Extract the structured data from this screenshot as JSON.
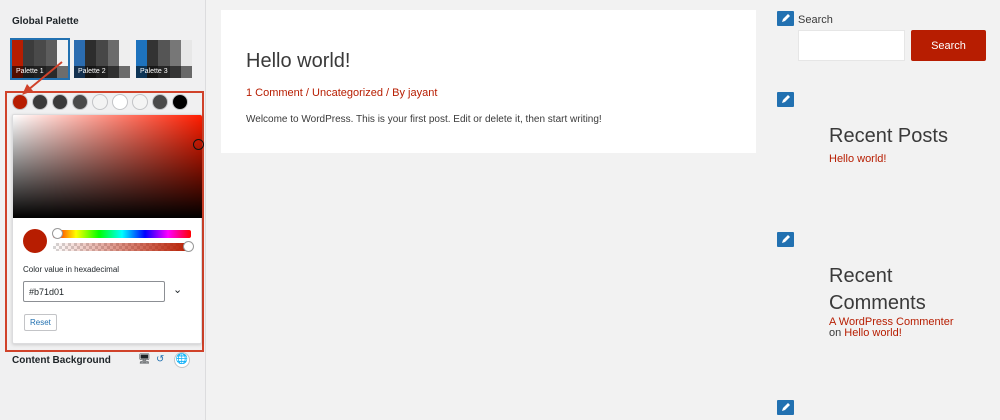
{
  "customizer": {
    "section_title": "Global Palette",
    "palettes": [
      {
        "label": "Palette 1",
        "colors": [
          "#b71d01",
          "#3c3c3c",
          "#4a4a4a",
          "#5d5d5d",
          "#f2f2f2"
        ],
        "active": true
      },
      {
        "label": "Palette 2",
        "colors": [
          "#2b6cb0",
          "#2d2d2d",
          "#474747",
          "#6b6b6b",
          "#eeeeee"
        ],
        "active": false
      },
      {
        "label": "Palette 3",
        "colors": [
          "#1e73be",
          "#333333",
          "#555555",
          "#777777",
          "#e7e7e7"
        ],
        "active": false
      }
    ],
    "swatches": [
      "#b71d01",
      "#3a3a3a",
      "#3a3a3a",
      "#4a4a4a",
      "#f3f3f3",
      "#ffffff",
      "#f4f4f4",
      "#4a4a4a",
      "#000000"
    ],
    "picker": {
      "current_color": "#b71d01",
      "hex_label": "Color value in hexadecimal",
      "hex_value": "#b71d01",
      "toggle_icon": "chevron-down-icon",
      "reset_label": "Reset"
    },
    "content_background_label": "Content Background",
    "content_background_icons": [
      "desktop-icon",
      "undo-icon",
      "globe-icon"
    ]
  },
  "post": {
    "title": "Hello world!",
    "comments_link": "1 Comment",
    "sep1": " / ",
    "category_link": "Uncategorized",
    "by_text": " / By ",
    "author_link": "jayant",
    "excerpt": "Welcome to WordPress. This is your first post. Edit or delete it, then start writing!"
  },
  "sidebar": {
    "search_label": "Search",
    "search_button": "Search",
    "recent_posts_title": "Recent Posts",
    "recent_posts": [
      "Hello world!"
    ],
    "recent_comments_title_line1": "Recent",
    "recent_comments_title_line2": "Comments",
    "comment_author": "A WordPress Commenter",
    "comment_on": "on ",
    "comment_post": "Hello world!"
  },
  "colors": {
    "accent": "#b71d01",
    "highlight_box": "#d0422a",
    "edit_icon": "#2271b1"
  }
}
